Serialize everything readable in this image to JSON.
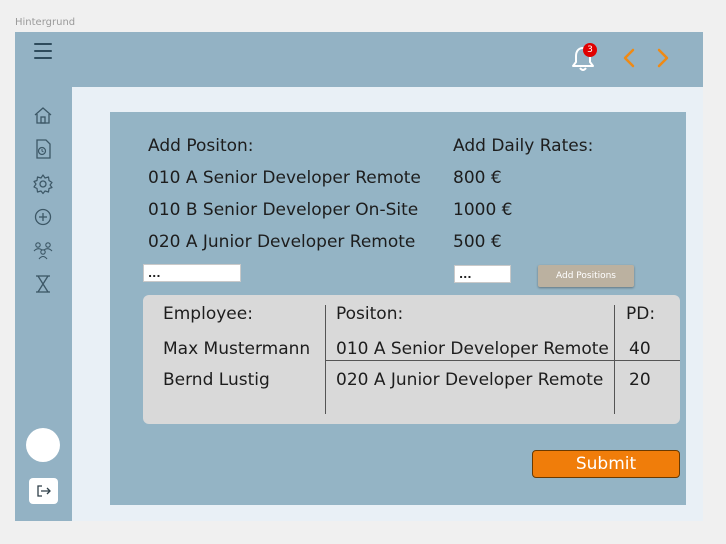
{
  "frame": {
    "label": "Hintergrund"
  },
  "header": {
    "notification_count": "3",
    "colors": {
      "bar": "#93b2c4",
      "arrows": "#f08a14",
      "badge": "#e00000"
    }
  },
  "sidebar": {
    "icons": [
      "home-icon",
      "document-icon",
      "settings-icon",
      "plus-circle-icon",
      "team-icon",
      "hourglass-icon"
    ]
  },
  "form": {
    "position_heading": "Add Positon:",
    "rate_heading": "Add Daily Rates:",
    "rows": [
      {
        "position": "010 A Senior Developer Remote",
        "rate": "800 €"
      },
      {
        "position": "010 B Senior Developer  On-Site",
        "rate": "1000 €"
      },
      {
        "position": "020 A Junior Developer Remote",
        "rate": "500 €"
      }
    ],
    "position_input_value": "...",
    "rate_input_value": "...",
    "add_button_label": "Add Positions"
  },
  "table": {
    "headers": [
      "Employee:",
      "Positon:",
      "PD:"
    ],
    "rows": [
      {
        "employee": "Max Mustermann",
        "position": "010 A Senior Developer Remote",
        "pd": "40"
      },
      {
        "employee": "Bernd Lustig",
        "position": "020 A Junior Developer Remote",
        "pd": "20"
      }
    ]
  },
  "submit_label": "Submit",
  "accent_color": "#f07d0a"
}
